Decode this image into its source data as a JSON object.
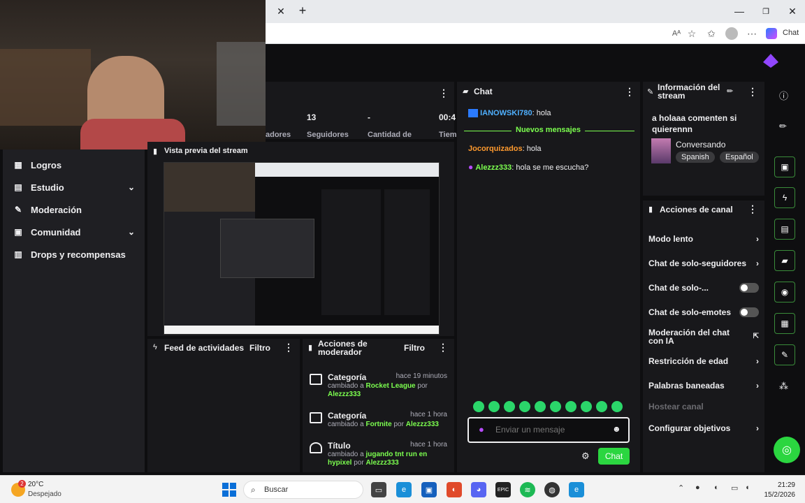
{
  "browser": {
    "right_label": "Chat"
  },
  "stats": [
    {
      "value": "13",
      "label": "Seguidores"
    },
    {
      "value": "-",
      "label": "Cantidad de"
    },
    {
      "value": "00:4",
      "label": "Tiem"
    }
  ],
  "stats_left_label": "adores",
  "preview": {
    "title": "Vista previa del stream"
  },
  "sidebar": {
    "items": [
      {
        "label": "Logros",
        "icon": "trophy-icon",
        "chevron": false
      },
      {
        "label": "Estudio",
        "icon": "studio-icon",
        "chevron": true
      },
      {
        "label": "Moderación",
        "icon": "wrench-icon",
        "chevron": false
      },
      {
        "label": "Comunidad",
        "icon": "community-icon",
        "chevron": true
      },
      {
        "label": "Drops y recompensas",
        "icon": "gift-icon",
        "chevron": false
      }
    ]
  },
  "activity": {
    "title": "Feed de actividades",
    "filter": "Filtro"
  },
  "modactions": {
    "title": "Acciones de moderador",
    "filter": "Filtro",
    "items": [
      {
        "title": "Categoría",
        "time": "hace 19 minutos",
        "prefix": "cambiado a",
        "value": "Rocket League",
        "by": "por",
        "user": "Alezzz333"
      },
      {
        "title": "Categoría",
        "time": "hace 1 hora",
        "prefix": "cambiado a",
        "value": "Fortnite",
        "by": "por",
        "user": "Alezzz333"
      },
      {
        "title": "Título",
        "time": "hace 1 hora",
        "prefix": "cambiado a",
        "value": "jugando tnt run en hypixel",
        "by": "por",
        "user": "Alezzz333"
      }
    ]
  },
  "chat": {
    "title": "Chat",
    "messages": [
      {
        "user": "IANOWSKI780",
        "text": ": hola"
      },
      {
        "user": "Jocorquizados",
        "text": ": hola"
      },
      {
        "user": "Alezzz333",
        "text": ": hola se me escucha?"
      }
    ],
    "new_messages": "Nuevos mensajes",
    "input_placeholder": "Enviar un mensaje",
    "send_label": "Chat"
  },
  "info": {
    "title": "Información del stream",
    "stream_title": "a holaaa comenten si quierennn",
    "category": "Conversando",
    "tags": [
      "Spanish",
      "Español"
    ]
  },
  "channel_actions": {
    "title": "Acciones de canal",
    "items": [
      {
        "label": "Modo lento",
        "kind": "chevron"
      },
      {
        "label": "Chat de solo-seguidores",
        "kind": "chevron"
      },
      {
        "label": "Chat de solo-...",
        "kind": "toggle"
      },
      {
        "label": "Chat de solo-emotes",
        "kind": "toggle"
      },
      {
        "label": "Moderación del chat con IA",
        "kind": "external"
      },
      {
        "label": "Restricción de edad",
        "kind": "chevron"
      },
      {
        "label": "Palabras baneadas",
        "kind": "chevron"
      },
      {
        "label": "Hostear canal",
        "kind": "disabled"
      },
      {
        "label": "Configurar objetivos",
        "kind": "chevron"
      }
    ]
  },
  "taskbar": {
    "weather_temp": "20°C",
    "weather_desc": "Despejado",
    "weather_badge": "2",
    "search": "Buscar",
    "time": "21:29",
    "date": "15/2/2026"
  },
  "colors": {
    "accent": "#7cff4f",
    "brand": "#9146ff",
    "chat_user_blue": "#4fb0ff"
  }
}
